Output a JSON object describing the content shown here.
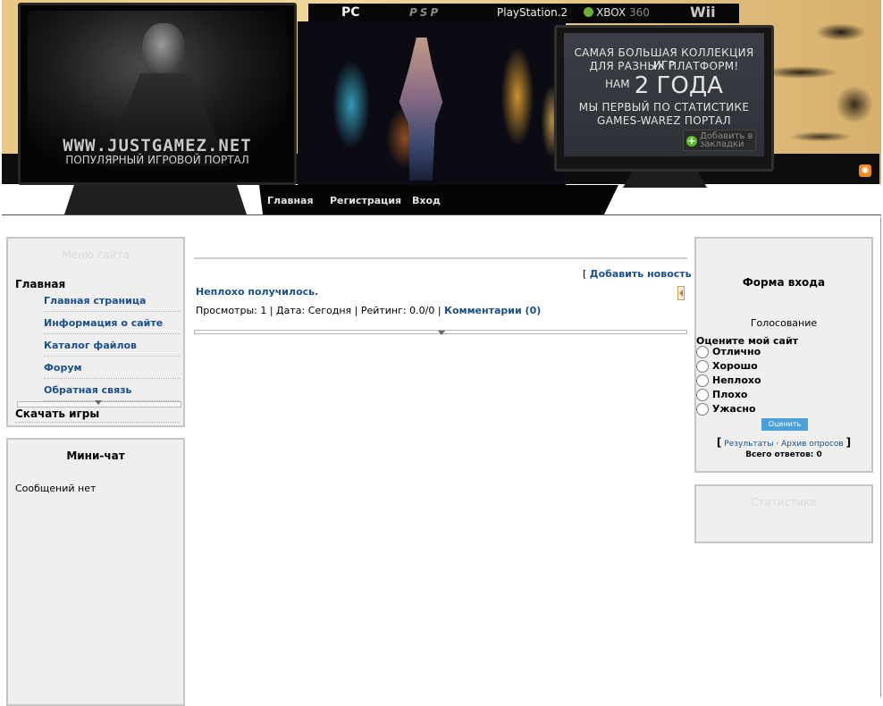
{
  "header": {
    "site_url": "WWW.JUSTGAMEZ.NET",
    "site_tagline": "ПОПУЛЯРНЫЙ ИГРОВОЙ ПОРТАЛ",
    "platforms": [
      "PC",
      "PSP",
      "PlayStation.2",
      "XBOX",
      "360",
      "Wii"
    ],
    "promo": {
      "line1": "САМАЯ БОЛЬШАЯ КОЛЛЕКЦИЯ ИГР",
      "line2": "ДЛЯ РАЗНЫХ ПЛАТФОРМ!",
      "line3_prefix": "НАМ",
      "line3_big": "2 ГОДА",
      "line4": "МЫ ПЕРВЫЙ ПО СТАТИСТИКЕ",
      "line5": "GAMES-WAREZ ПОРТАЛ"
    },
    "bookmark_label": "Добавить в закладки",
    "rss_icon": "rss-icon",
    "nav": [
      "Главная",
      "Регистрация",
      "Вход"
    ]
  },
  "site_menu": {
    "title": "Меню сайта",
    "section_main": "Главная",
    "items": [
      "Главная страница",
      "Информация о сайте",
      "Каталог файлов",
      "Форум",
      "Обратная связь"
    ],
    "section_download": "Скачать игры"
  },
  "mini_chat": {
    "title": "Мини-чат",
    "empty_text": "Сообщений нет"
  },
  "news": {
    "add_news_label": "Добавить новость",
    "entry_title": "Неплохо получилось.",
    "views_label": "Просмотры:",
    "views": "1",
    "date_label": "Дата:",
    "date": "Сегодня",
    "rating_label": "Рейтинг:",
    "rating": "0.0/0",
    "comments_label": "Комментарии (0)"
  },
  "login_form": {
    "title": "Форма входа"
  },
  "poll": {
    "title": "Голосование",
    "question": "Оцените мой сайт",
    "options": [
      "Отлично",
      "Хорошо",
      "Неплохо",
      "Плохо",
      "Ужасно"
    ],
    "vote_button": "Оценить",
    "results_link": "Результаты",
    "archive_link": "Архив опросов",
    "separator": "·",
    "total_label": "Всего ответов:",
    "total": "0"
  },
  "statistics": {
    "title": "Статистика"
  },
  "colors": {
    "link": "#1a4f8c",
    "block_bg": "#efefef",
    "block_border": "#c6c6c6",
    "vote_button": "#4aa0d8",
    "header_gold": "#e8c985"
  }
}
